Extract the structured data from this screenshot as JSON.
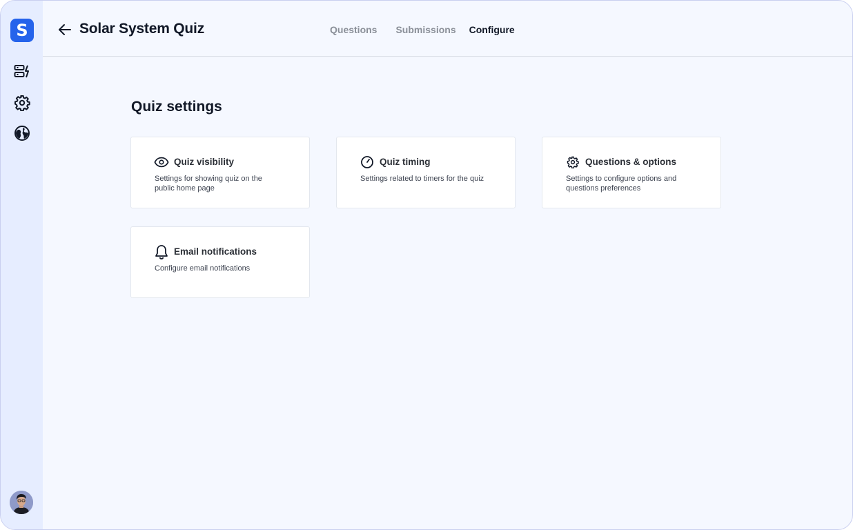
{
  "app": {
    "logo_letter": "S",
    "brand_color": "#2563eb"
  },
  "sidebar": {
    "items": [
      {
        "icon": "dashboard-icon"
      },
      {
        "icon": "gear-icon"
      },
      {
        "icon": "globe-icon"
      }
    ],
    "avatar": "user-avatar"
  },
  "header": {
    "back_icon": "arrow-left-icon",
    "title": "Solar System Quiz",
    "tabs": [
      {
        "label": "Questions",
        "active": false
      },
      {
        "label": "Submissions",
        "active": false
      },
      {
        "label": "Configure",
        "active": true
      }
    ]
  },
  "main": {
    "section_title": "Quiz settings",
    "cards": [
      {
        "icon": "eye-icon",
        "title": "Quiz visibility",
        "description": "Settings for showing quiz on the public home page"
      },
      {
        "icon": "timer-icon",
        "title": "Quiz timing",
        "description": "Settings related to timers for the quiz"
      },
      {
        "icon": "gear-icon",
        "title": "Questions & options",
        "description": "Settings to configure options and questions preferences"
      },
      {
        "icon": "bell-icon",
        "title": "Email notifications",
        "description": "Configure email notifications"
      }
    ]
  }
}
